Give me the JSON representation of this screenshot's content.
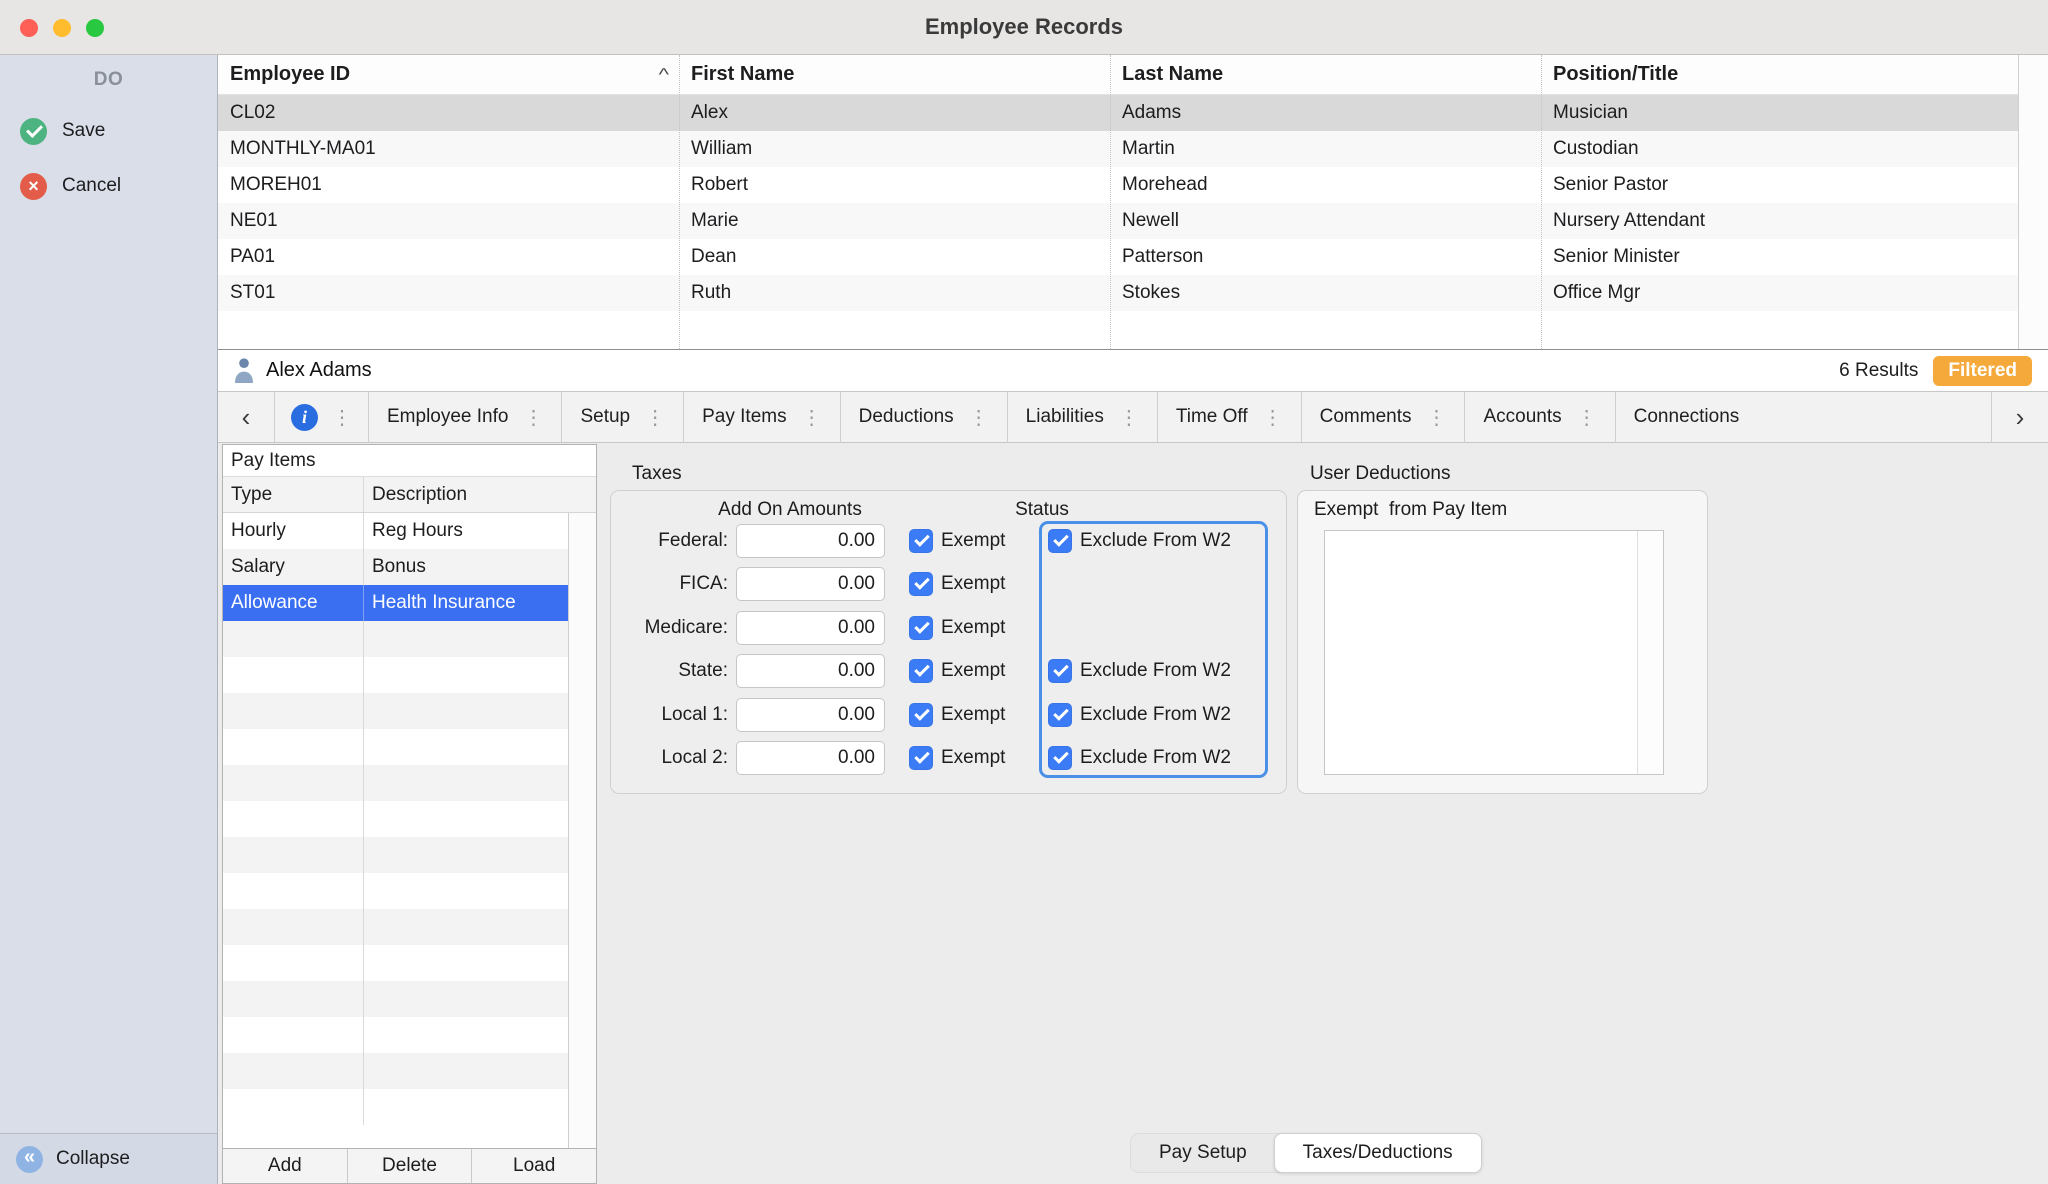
{
  "window": {
    "title": "Employee Records"
  },
  "colors": {
    "accent_blue": "#3b7cf6",
    "selection_blue": "#3a6ff2",
    "badge_orange": "#f6a93b",
    "focus_ring": "#4a90e8"
  },
  "sidebar": {
    "header": "DO",
    "actions": [
      {
        "label": "Save",
        "icon": "check-circle-icon"
      },
      {
        "label": "Cancel",
        "icon": "x-circle-icon"
      }
    ],
    "collapse_label": "Collapse",
    "collapse_glyph": "«"
  },
  "employee_table": {
    "columns": [
      "Employee ID",
      "First Name",
      "Last Name",
      "Position/Title"
    ],
    "sort_glyph": "^",
    "selected_index": 0,
    "rows": [
      [
        "CL02",
        "Alex",
        "Adams",
        "Musician"
      ],
      [
        "MONTHLY-MA01",
        "William",
        "Martin",
        "Custodian"
      ],
      [
        "MOREH01",
        "Robert",
        "Morehead",
        "Senior Pastor"
      ],
      [
        "NE01",
        "Marie",
        "Newell",
        "Nursery Attendant"
      ],
      [
        "PA01",
        "Dean",
        "Patterson",
        "Senior Minister"
      ],
      [
        "ST01",
        "Ruth",
        "Stokes",
        "Office Mgr"
      ]
    ]
  },
  "record_bar": {
    "name": "Alex Adams",
    "results": "6 Results",
    "badge": "Filtered"
  },
  "tab_strip": {
    "scroll_left_glyph": "‹",
    "scroll_right_glyph": "›",
    "info_glyph": "i",
    "menu_glyph": "⋮",
    "tabs": [
      "Employee Info",
      "Setup",
      "Pay Items",
      "Deductions",
      "Liabilities",
      "Time Off",
      "Comments",
      "Accounts",
      "Connections"
    ]
  },
  "pay_items": {
    "title": "Pay Items",
    "columns": [
      "Type",
      "Description"
    ],
    "selected_index": 2,
    "rows": [
      [
        "Hourly",
        "Reg Hours"
      ],
      [
        "Salary",
        "Bonus"
      ],
      [
        "Allowance",
        "Health Insurance"
      ]
    ],
    "buttons": [
      "Add",
      "Delete",
      "Load"
    ]
  },
  "taxes": {
    "heading": "Taxes",
    "amounts_header": "Add On Amounts",
    "status_header": "Status",
    "exempt_label": "Exempt",
    "exclude_label": "Exclude From W2",
    "rows": [
      {
        "label": "Federal:",
        "amount": "0.00",
        "exempt": true,
        "exclude_w2": true
      },
      {
        "label": "FICA:",
        "amount": "0.00",
        "exempt": true,
        "exclude_w2": null
      },
      {
        "label": "Medicare:",
        "amount": "0.00",
        "exempt": true,
        "exclude_w2": null
      },
      {
        "label": "State:",
        "amount": "0.00",
        "exempt": true,
        "exclude_w2": true
      },
      {
        "label": "Local 1:",
        "amount": "0.00",
        "exempt": true,
        "exclude_w2": true
      },
      {
        "label": "Local 2:",
        "amount": "0.00",
        "exempt": true,
        "exclude_w2": true
      }
    ]
  },
  "user_deductions": {
    "heading": "User Deductions",
    "exempt_label": "Exempt  from Pay Item"
  },
  "bottom_tabs": {
    "items": [
      "Pay Setup",
      "Taxes/Deductions"
    ],
    "selected_index": 1
  }
}
